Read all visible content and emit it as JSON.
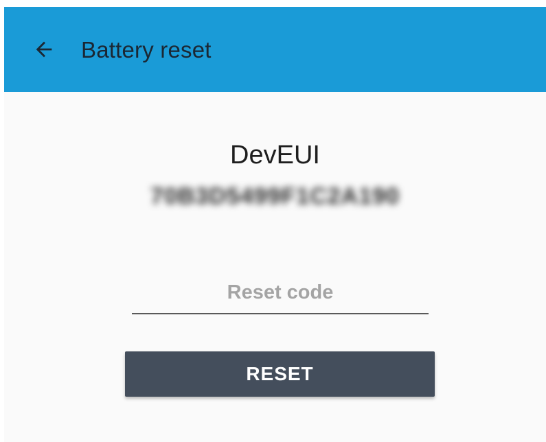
{
  "app_bar": {
    "title": "Battery reset",
    "back_icon": "arrow-left-icon",
    "background": "#1a9bd7"
  },
  "device": {
    "label": "DevEUI",
    "value": "70B3D5499F1C2A190"
  },
  "reset_code": {
    "placeholder": "Reset code",
    "value": ""
  },
  "actions": {
    "reset_label": "RESET",
    "button_color": "#444e5c"
  }
}
